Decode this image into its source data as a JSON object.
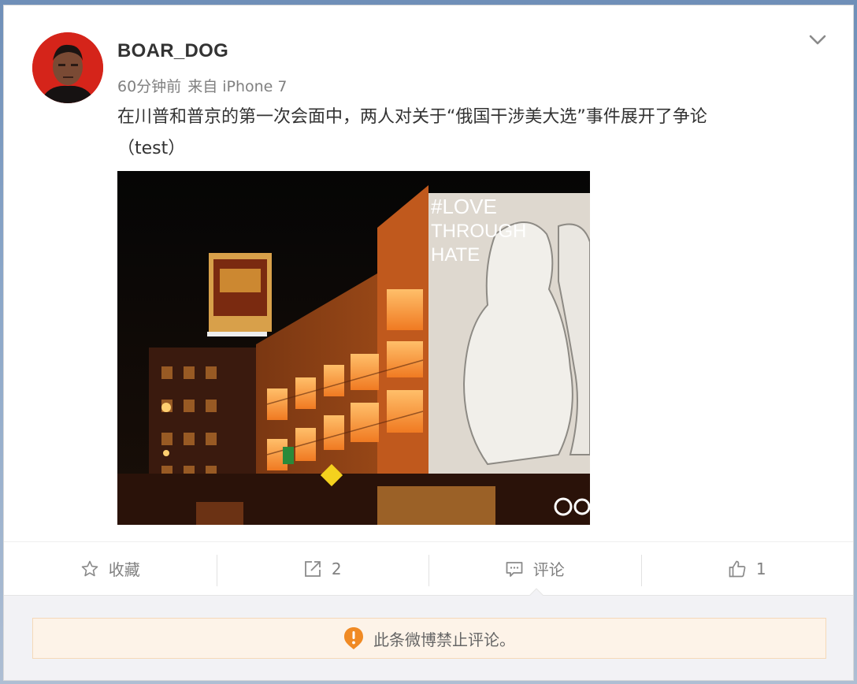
{
  "post": {
    "username": "BOAR_DOG",
    "time": "60分钟前",
    "source": "来自 iPhone 7",
    "text_line1": "在川普和普京的第一次会面中，两人对关于“俄国干涉美大选”事件展开了争论",
    "text_line2": "（test）",
    "image_text": [
      "#LOVE",
      "THROUGH",
      "HATE"
    ]
  },
  "actions": {
    "favorite_label": "收藏",
    "repost_count": "2",
    "comment_label": "评论",
    "like_count": "1"
  },
  "comments": {
    "disabled_notice": "此条微博禁止评论。"
  },
  "colors": {
    "accent": "#f08a24",
    "text": "#333333",
    "muted": "#808080"
  }
}
